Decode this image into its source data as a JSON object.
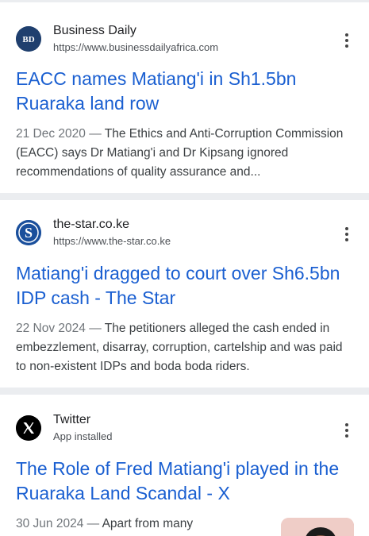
{
  "results": [
    {
      "source_name": "Business Daily",
      "source_url": "https://www.businessdailyafrica.com",
      "favicon_text": "BD",
      "title": "EACC names Matiang'i in Sh1.5bn Ruaraka land row",
      "date": "21 Dec 2020",
      "separator": " — ",
      "snippet": "The Ethics and Anti-Corruption Commission (EACC) says Dr Matiang'i and Dr Kipsang ignored recommendations of quality assurance and..."
    },
    {
      "source_name": "the-star.co.ke",
      "source_url": "https://www.the-star.co.ke",
      "favicon_text": "S",
      "title": "Matiang'i dragged to court over Sh6.5bn IDP cash - The Star",
      "date": "22 Nov 2024",
      "separator": " — ",
      "snippet": "The petitioners alleged the cash ended in embezzlement, disarray, corruption, cartelship and was paid to non-existent IDPs and boda boda riders."
    },
    {
      "source_name": "Twitter",
      "source_url": "App installed",
      "favicon_text": "X",
      "title": "The Role of Fred Matiang'i played in the Ruaraka Land Scandal - X",
      "date": "30 Jun 2024",
      "separator": " — ",
      "snippet": "Apart from many"
    }
  ],
  "colors": {
    "link": "#1a5fd1",
    "separator_band": "#ebedf0",
    "bd_favicon": "#1f3f6e",
    "star_favicon": "#1a4f9c",
    "x_favicon": "#000000"
  },
  "icons": [
    "businessdaily-favicon",
    "the-star-favicon",
    "x-logo-icon",
    "more-vert-icon"
  ]
}
